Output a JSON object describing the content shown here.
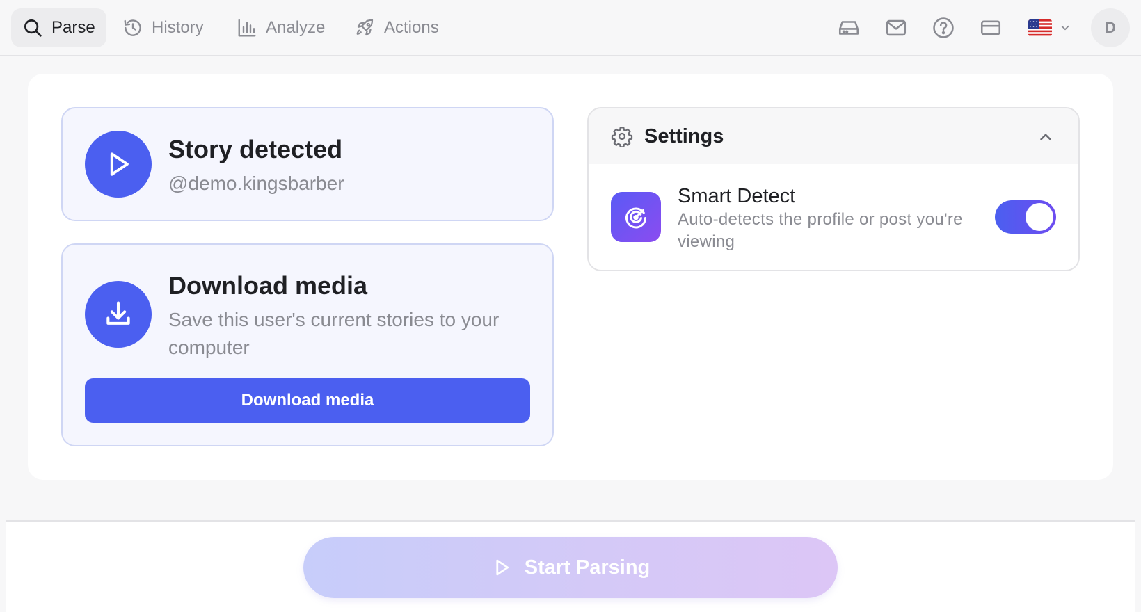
{
  "nav": {
    "tabs": [
      {
        "label": "Parse",
        "icon": "search-icon",
        "active": true
      },
      {
        "label": "History",
        "icon": "history-icon",
        "active": false
      },
      {
        "label": "Analyze",
        "icon": "bar-chart-icon",
        "active": false
      },
      {
        "label": "Actions",
        "icon": "rocket-icon",
        "active": false
      }
    ],
    "right_icons": [
      "inbox-icon",
      "mail-icon",
      "help-icon",
      "card-icon"
    ],
    "language_flag": "us-flag-icon",
    "avatar_initial": "D"
  },
  "story_card": {
    "title": "Story detected",
    "username": "@demo.kingsbarber",
    "icon": "play-icon"
  },
  "download_card": {
    "title": "Download media",
    "description": "Save this user's current stories to your computer",
    "button_label": "Download media",
    "icon": "download-icon"
  },
  "settings": {
    "title": "Settings",
    "expanded": true,
    "smart_detect": {
      "title": "Smart Detect",
      "description": "Auto-detects the profile or post you're viewing",
      "enabled": true,
      "icon": "radar-icon"
    }
  },
  "footer": {
    "start_label": "Start Parsing",
    "icon": "play-icon"
  },
  "colors": {
    "accent": "#4b5ff0",
    "muted_text": "#8a8b92",
    "card_border": "#cfd6f4"
  }
}
